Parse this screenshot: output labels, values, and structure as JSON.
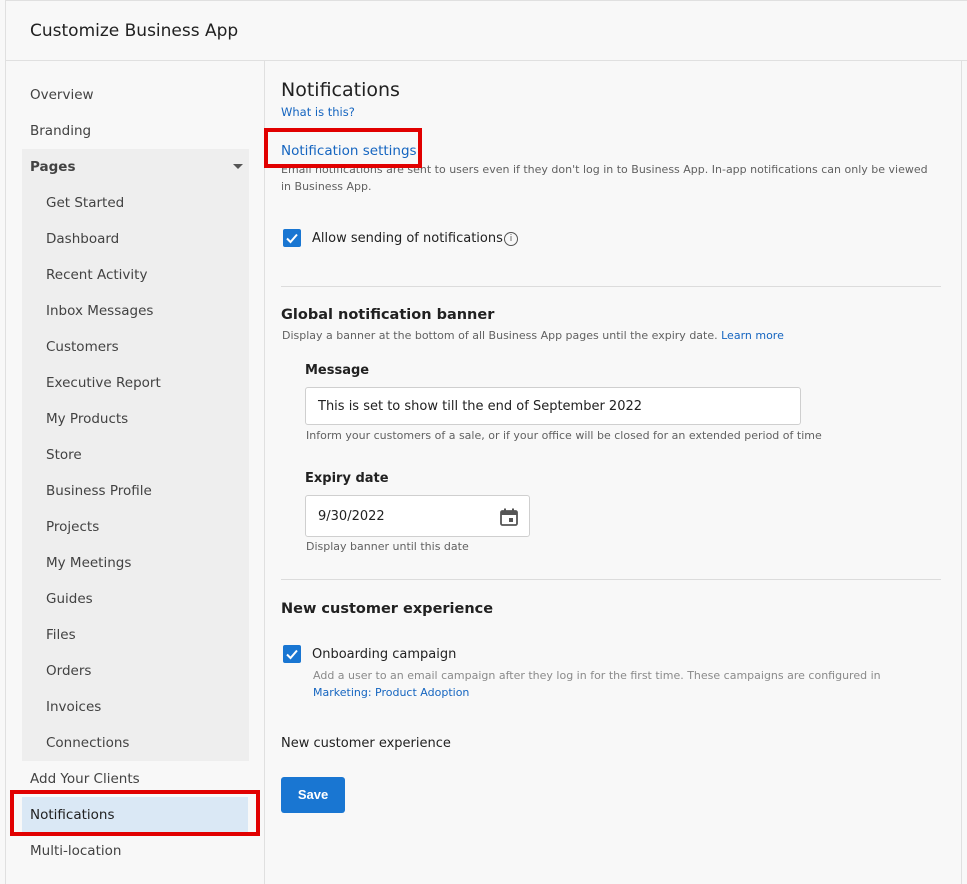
{
  "header": {
    "title": "Customize Business App"
  },
  "sidebar": {
    "overview": "Overview",
    "branding": "Branding",
    "pages_label": "Pages",
    "pages": [
      "Get Started",
      "Dashboard",
      "Recent Activity",
      "Inbox Messages",
      "Customers",
      "Executive Report",
      "My Products",
      "Store",
      "Business Profile",
      "Projects",
      "My Meetings",
      "Guides",
      "Files",
      "Orders",
      "Invoices",
      "Connections"
    ],
    "add_clients": "Add Your Clients",
    "notifications": "Notifications",
    "multi_location": "Multi-location"
  },
  "main": {
    "title": "Notifications",
    "what_is_this": "What is this?",
    "settings_link": "Notification settings",
    "settings_desc": "Email notifications are sent to users even if they don't log in to Business App. In-app notifications can only be viewed in Business App.",
    "allow_label": "Allow sending of notifications",
    "banner_title": "Global notification banner",
    "banner_desc": "Display a banner at the bottom of all Business App pages until the expiry date.",
    "learn_more": "Learn more",
    "message_label": "Message",
    "message_value": "This is set to show till the end of September 2022",
    "message_hint": "Inform your customers of a sale, or if your office will be closed for an extended period of time",
    "expiry_label": "Expiry date",
    "expiry_value": "9/30/2022",
    "expiry_hint": "Display banner until this date",
    "nce_title": "New customer experience",
    "onboarding_label": "Onboarding campaign",
    "onboarding_desc": "Add a user to an email campaign after they log in for the first time. These campaigns are configured in",
    "marketing_link": "Marketing:",
    "product_adoption_link": "Product Adoption",
    "nce_footer": "New customer experience",
    "save_label": "Save"
  },
  "colors": {
    "accent": "#1976d2",
    "highlight": "#e10000",
    "active_bg": "#dae8f5"
  },
  "icons": {
    "info": "info-icon",
    "calendar": "calendar-icon",
    "check": "check-icon",
    "caret": "chevron-down-icon"
  }
}
